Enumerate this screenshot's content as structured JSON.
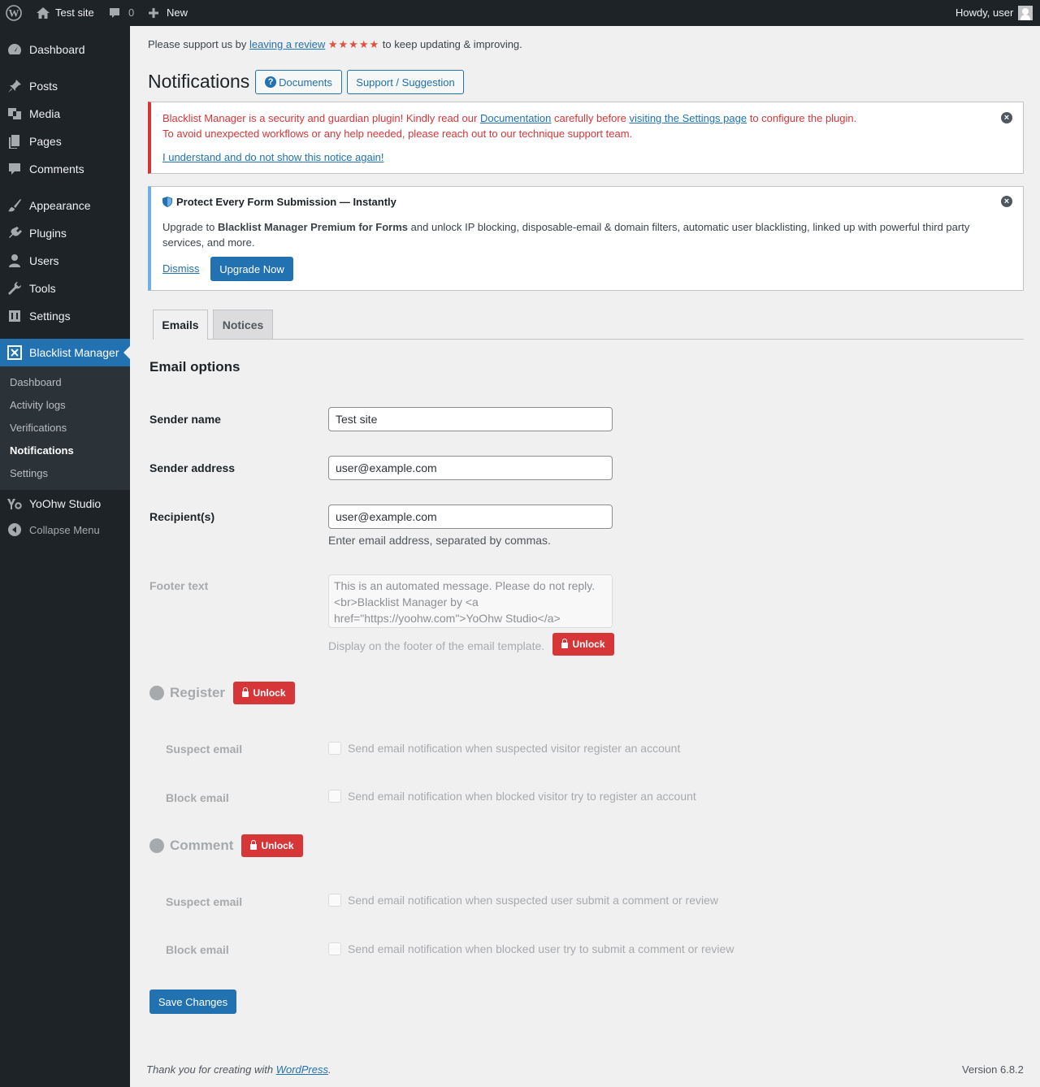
{
  "adminbar": {
    "site_name": "Test site",
    "comments_count": "0",
    "new_label": "New",
    "howdy": "Howdy, user"
  },
  "sidebar": {
    "items": [
      {
        "label": "Dashboard",
        "icon": "dashboard-icon"
      },
      {
        "label": "Posts",
        "icon": "pin-icon"
      },
      {
        "label": "Media",
        "icon": "media-icon"
      },
      {
        "label": "Pages",
        "icon": "pages-icon"
      },
      {
        "label": "Comments",
        "icon": "comment-icon"
      },
      {
        "label": "Appearance",
        "icon": "brush-icon"
      },
      {
        "label": "Plugins",
        "icon": "plug-icon"
      },
      {
        "label": "Users",
        "icon": "user-icon"
      },
      {
        "label": "Tools",
        "icon": "wrench-icon"
      },
      {
        "label": "Settings",
        "icon": "sliders-icon"
      },
      {
        "label": "Blacklist Manager",
        "icon": "blacklist-icon"
      },
      {
        "label": "YoOhw Studio",
        "icon": "yo-icon"
      },
      {
        "label": "Collapse Menu",
        "icon": "collapse-icon"
      }
    ],
    "submenu": [
      "Dashboard",
      "Activity logs",
      "Verifications",
      "Notifications",
      "Settings"
    ]
  },
  "banner": {
    "prefix": "Please support us by",
    "link": "leaving a review",
    "stars": "★★★★★",
    "suffix": "to keep updating & improving."
  },
  "header": {
    "title": "Notifications",
    "documents_label": "Documents",
    "support_label": "Support / Suggestion"
  },
  "notice_error": {
    "line1_a": "Blacklist Manager is a security and guardian plugin! Kindly read our",
    "line1_link1": "Documentation",
    "line1_b": "carefully before",
    "line1_link2": "visiting the Settings page",
    "line1_c": "to configure the plugin.",
    "line2": "To avoid unexpected workflows or any help needed, please reach out to our technique support team.",
    "dismiss_link": "I understand and do not show this notice again!"
  },
  "notice_info": {
    "title": "Protect Every Form Submission — Instantly",
    "body_a": "Upgrade to",
    "body_bold": "Blacklist Manager Premium for Forms",
    "body_b": "and unlock IP blocking, disposable-email & domain filters, automatic user blacklisting, linked up with powerful third party services, and more.",
    "dismiss": "Dismiss",
    "upgrade": "Upgrade Now"
  },
  "tabs": [
    "Emails",
    "Notices"
  ],
  "form": {
    "section_title": "Email options",
    "sender_name_label": "Sender name",
    "sender_name_value": "Test site",
    "sender_address_label": "Sender address",
    "sender_address_value": "user@example.com",
    "recipients_label": "Recipient(s)",
    "recipients_value": "user@example.com",
    "recipients_desc": "Enter email address, separated by commas.",
    "footer_label": "Footer text",
    "footer_value": "This is an automated message. Please do not reply.<br>Blacklist Manager by <a href=\"https://yoohw.com\">YoOhw Studio</a>",
    "footer_desc": "Display on the footer of the email template.",
    "unlock": "Unlock"
  },
  "register": {
    "title": "Register",
    "suspect_label": "Suspect email",
    "suspect_text": "Send email notification when suspected visitor register an account",
    "block_label": "Block email",
    "block_text": "Send email notification when blocked visitor try to register an account"
  },
  "comment": {
    "title": "Comment",
    "suspect_label": "Suspect email",
    "suspect_text": "Send email notification when suspected user submit a comment or review",
    "block_label": "Block email",
    "block_text": "Send email notification when blocked user try to submit a comment or review"
  },
  "save_label": "Save Changes",
  "footer": {
    "thanks_prefix": "Thank you for creating with",
    "thanks_link": "WordPress",
    "thanks_suffix": ".",
    "version": "Version 6.8.2"
  },
  "colors": {
    "adminbar": "#1d2327",
    "accent": "#2271b1",
    "error": "#d63638",
    "info": "#72aee6"
  }
}
